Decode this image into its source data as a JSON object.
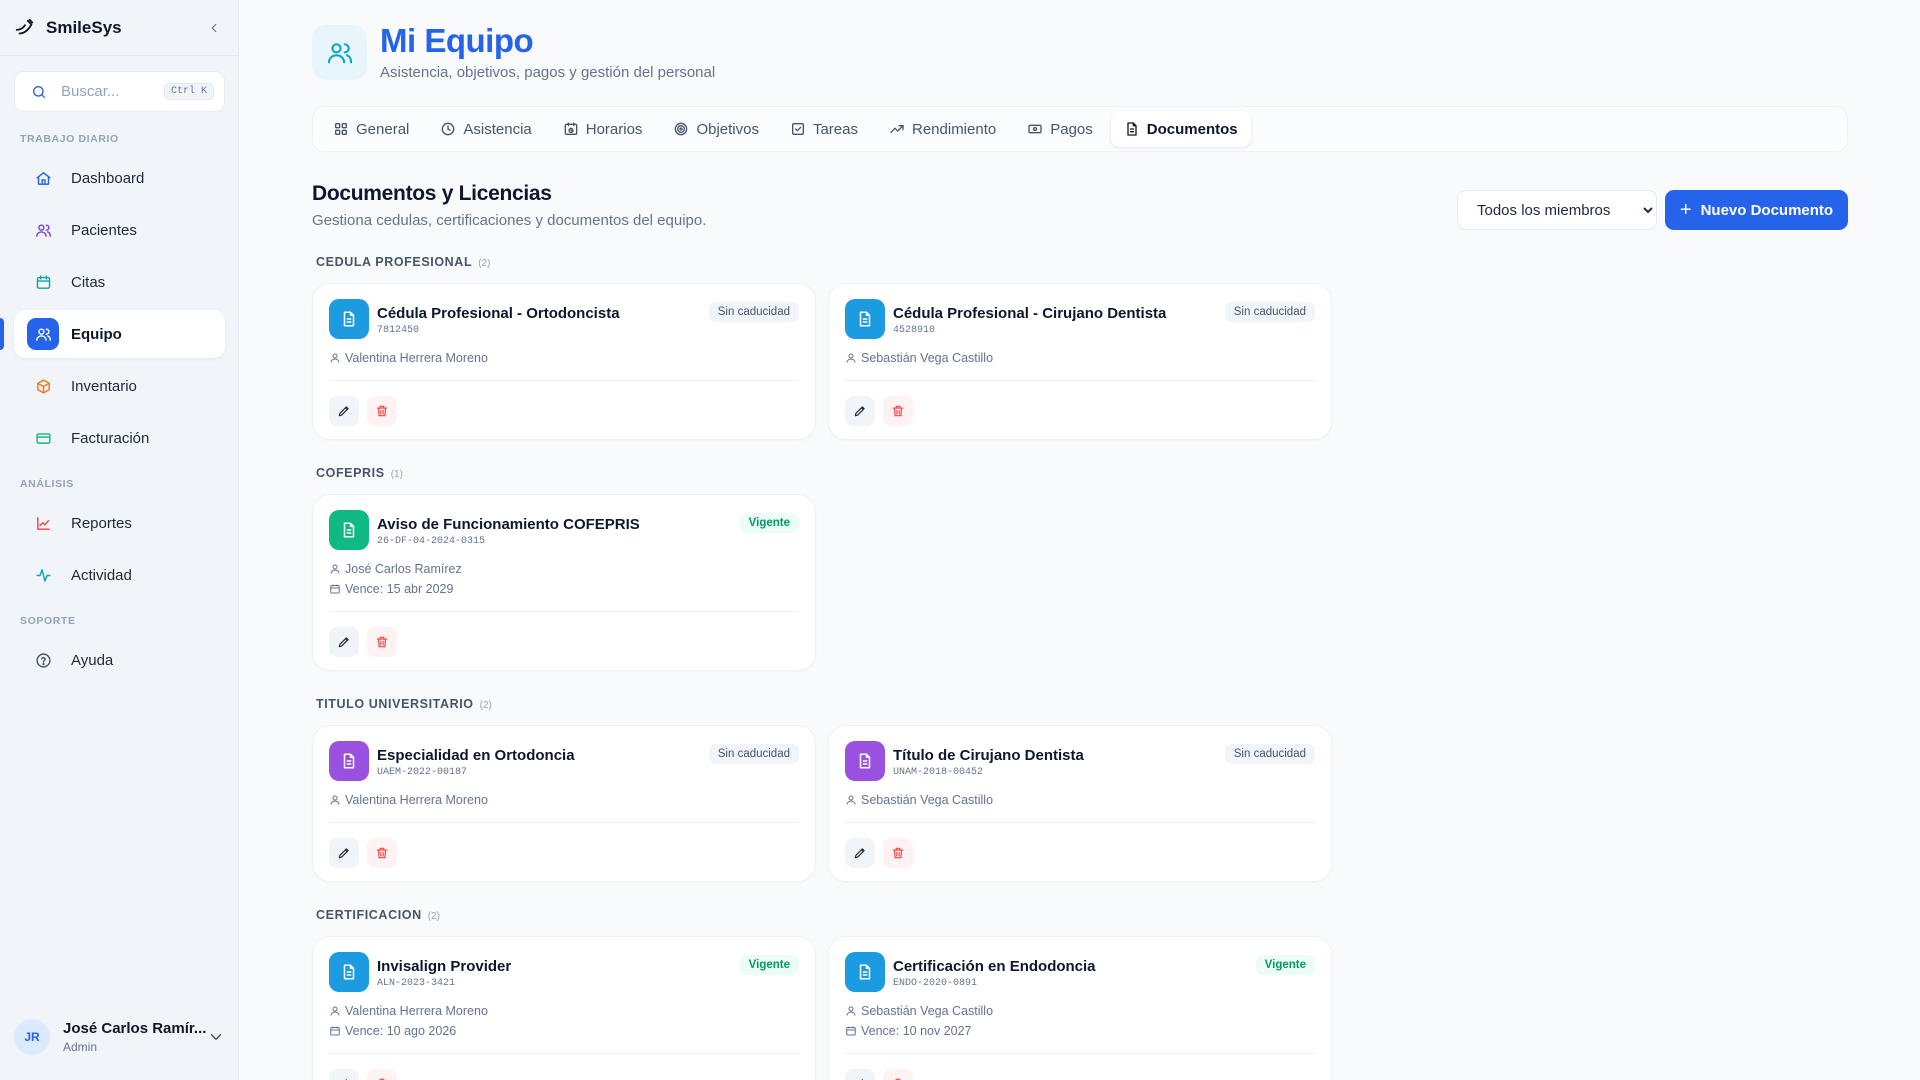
{
  "app": {
    "name": "SmileSys"
  },
  "search": {
    "placeholder": "Buscar...",
    "shortcut": "Ctrl K"
  },
  "sidebar": {
    "sections": [
      "TRABAJO DIARIO",
      "ANÁLISIS",
      "SOPORTE"
    ],
    "items": [
      {
        "label": "Dashboard",
        "icon": "home-icon",
        "color": "#2563eb"
      },
      {
        "label": "Pacientes",
        "icon": "users-icon",
        "color": "#7c3aed"
      },
      {
        "label": "Citas",
        "icon": "calendar-icon",
        "color": "#0ea5a4"
      },
      {
        "label": "Equipo",
        "icon": "team-icon",
        "color": "#ffffff",
        "active": true
      },
      {
        "label": "Inventario",
        "icon": "box-icon",
        "color": "#f97316"
      },
      {
        "label": "Facturación",
        "icon": "credit-card-icon",
        "color": "#10b981"
      },
      {
        "label": "Reportes",
        "icon": "chart-line-icon",
        "color": "#ef4444"
      },
      {
        "label": "Actividad",
        "icon": "activity-icon",
        "color": "#0ea5a4"
      },
      {
        "label": "Ayuda",
        "icon": "help-circle-icon",
        "color": "#475569"
      }
    ]
  },
  "user": {
    "initials": "JR",
    "name": "José Carlos Ramír...",
    "role": "Admin"
  },
  "header": {
    "title": "Mi Equipo",
    "subtitle": "Asistencia, objetivos, pagos y gestión del personal"
  },
  "tabs": [
    {
      "label": "General",
      "icon": "grid-icon"
    },
    {
      "label": "Asistencia",
      "icon": "clock-icon"
    },
    {
      "label": "Horarios",
      "icon": "calendar-clock-icon"
    },
    {
      "label": "Objetivos",
      "icon": "target-icon"
    },
    {
      "label": "Tareas",
      "icon": "checkbox-icon"
    },
    {
      "label": "Rendimiento",
      "icon": "trending-up-icon"
    },
    {
      "label": "Pagos",
      "icon": "banknote-icon"
    },
    {
      "label": "Documentos",
      "icon": "file-icon",
      "active": true
    }
  ],
  "documents": {
    "title": "Documentos y Licencias",
    "subtitle": "Gestiona cedulas, certificaciones y documentos del equipo.",
    "filter": {
      "selected": "Todos los miembros"
    },
    "new_button": "Nuevo Documento",
    "groups": [
      {
        "label": "CEDULA PROFESIONAL",
        "count": "(2)",
        "cards": [
          {
            "title": "Cédula Profesional - Ortodoncista",
            "code": "7812450",
            "badge": "Sin caducidad",
            "person": "Valentina Herrera Moreno",
            "color": "#1d9be0"
          },
          {
            "title": "Cédula Profesional - Cirujano Dentista",
            "code": "4528910",
            "badge": "Sin caducidad",
            "person": "Sebastián Vega Castillo",
            "color": "#1d9be0"
          }
        ]
      },
      {
        "label": "COFEPRIS",
        "count": "(1)",
        "cards": [
          {
            "title": "Aviso de Funcionamiento COFEPRIS",
            "code": "26-DF-04-2024-0315",
            "badge": "Vigente",
            "person": "José Carlos Ramírez",
            "expiry": "Vence: 15 abr 2029",
            "color": "#10b981"
          }
        ]
      },
      {
        "label": "TITULO UNIVERSITARIO",
        "count": "(2)",
        "cards": [
          {
            "title": "Especialidad en Ortodoncia",
            "code": "UAEM-2022-00187",
            "badge": "Sin caducidad",
            "person": "Valentina Herrera Moreno",
            "color": "#9b51e0"
          },
          {
            "title": "Título de Cirujano Dentista",
            "code": "UNAM-2018-00452",
            "badge": "Sin caducidad",
            "person": "Sebastián Vega Castillo",
            "color": "#9b51e0"
          }
        ]
      },
      {
        "label": "CERTIFICACION",
        "count": "(2)",
        "cards": [
          {
            "title": "Invisalign Provider",
            "code": "ALN-2023-3421",
            "badge": "Vigente",
            "person": "Valentina Herrera Moreno",
            "expiry": "Vence: 10 ago 2026",
            "color": "#1d9be0"
          },
          {
            "title": "Certificación en Endodoncia",
            "code": "ENDO-2020-0891",
            "badge": "Vigente",
            "person": "Sebastián Vega Castillo",
            "expiry": "Vence: 10 nov 2027",
            "color": "#1d9be0"
          }
        ]
      }
    ]
  }
}
